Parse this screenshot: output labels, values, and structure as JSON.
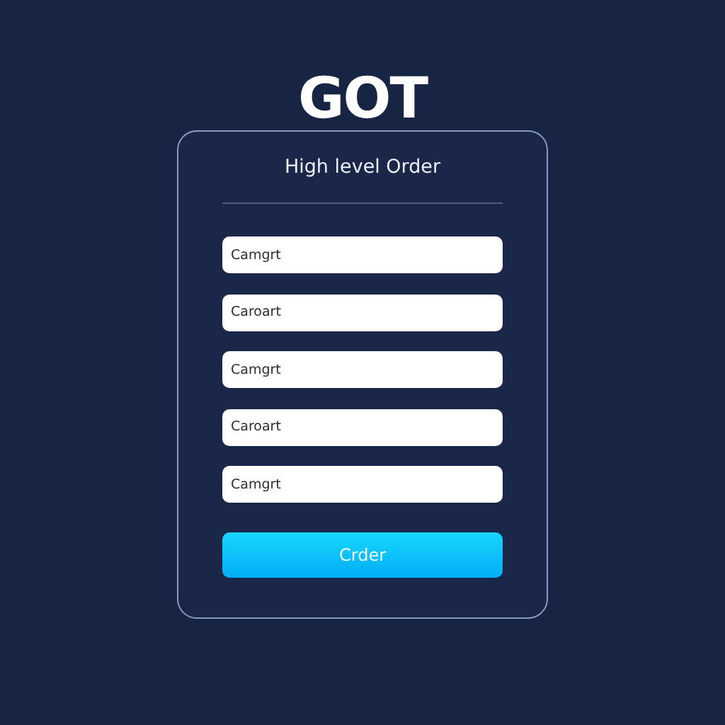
{
  "logo": "GOT",
  "form": {
    "title": "High level Order",
    "fields": [
      {
        "value": "Camgrt"
      },
      {
        "value": "Caroart"
      },
      {
        "value": "Camgrt"
      },
      {
        "value": "Caroart"
      },
      {
        "value": "Camgrt"
      }
    ],
    "button": "Crder"
  }
}
